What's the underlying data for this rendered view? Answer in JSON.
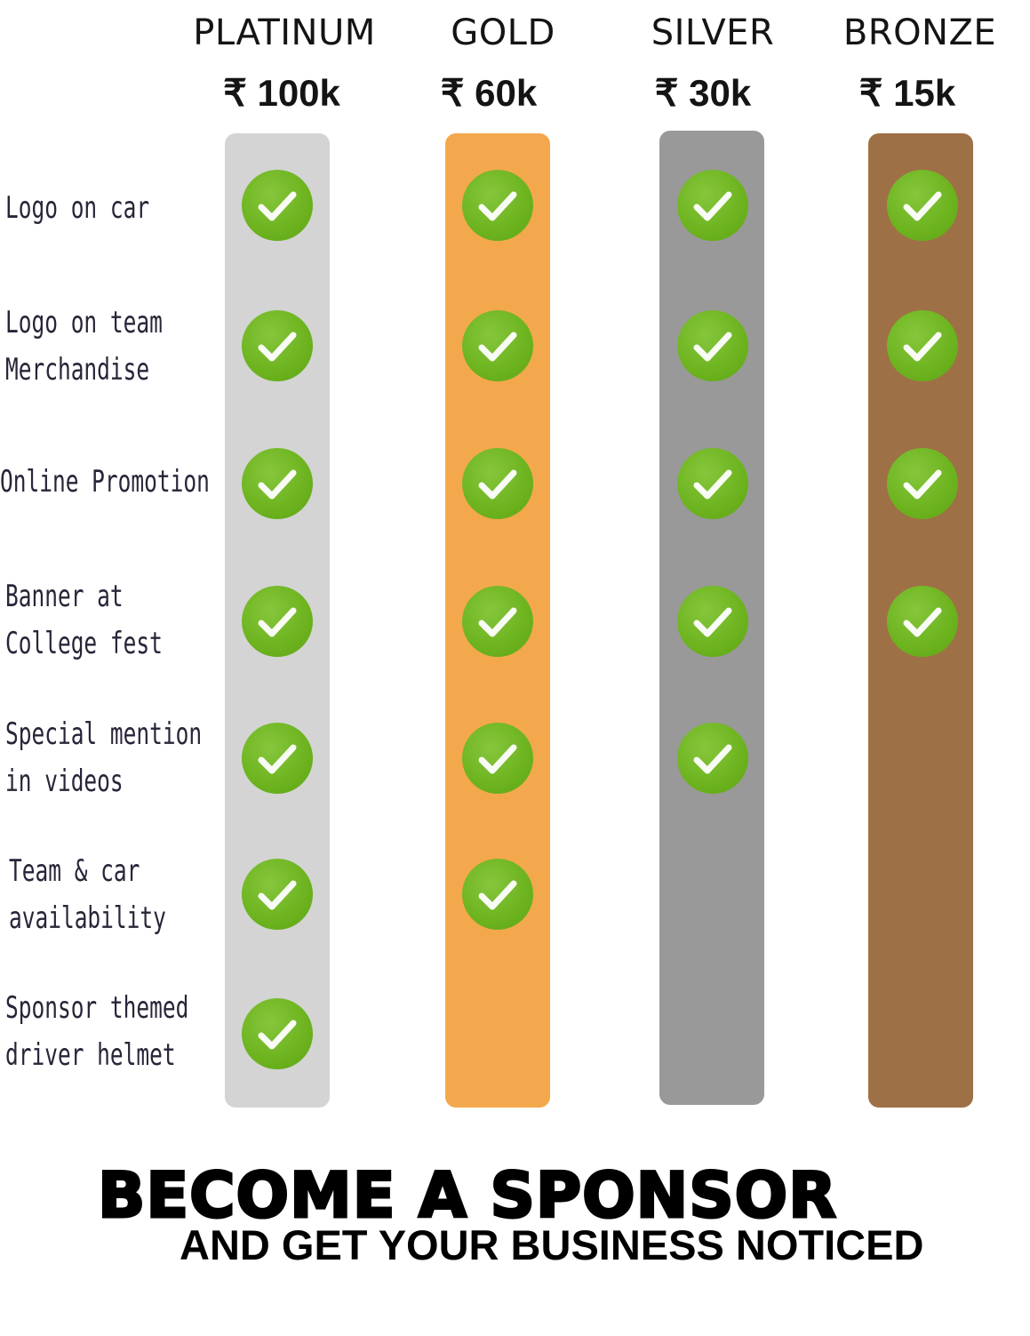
{
  "tiers": [
    {
      "name": "PLATINUM",
      "price": "₹ 100k",
      "color": "#d4d4d4"
    },
    {
      "name": "GOLD",
      "price": "₹ 60k",
      "color": "#f4a84d"
    },
    {
      "name": "SILVER",
      "price": "₹ 30k",
      "color": "#999999"
    },
    {
      "name": "BRONZE",
      "price": "₹ 15k",
      "color": "#9e7045"
    }
  ],
  "features": [
    {
      "label": "Logo on car",
      "included_count": 4
    },
    {
      "label": "Logo on team\nMerchandise",
      "included_count": 4
    },
    {
      "label": "Online Promotion",
      "included_count": 4
    },
    {
      "label": "Banner at\nCollege fest",
      "included_count": 4
    },
    {
      "label": "Special mention\nin videos",
      "included_count": 3
    },
    {
      "label": "Team & car\navailability",
      "included_count": 2
    },
    {
      "label": "Sponsor themed\ndriver helmet",
      "included_count": 1
    }
  ],
  "cta": {
    "title": "BECOME A SPONSOR",
    "subtitle": "AND GET YOUR BUSINESS NOTICED"
  },
  "colors": {
    "check_green": "#6cb31e",
    "text_dark": "#141414"
  },
  "icons": {
    "check": "check-circle-icon"
  }
}
